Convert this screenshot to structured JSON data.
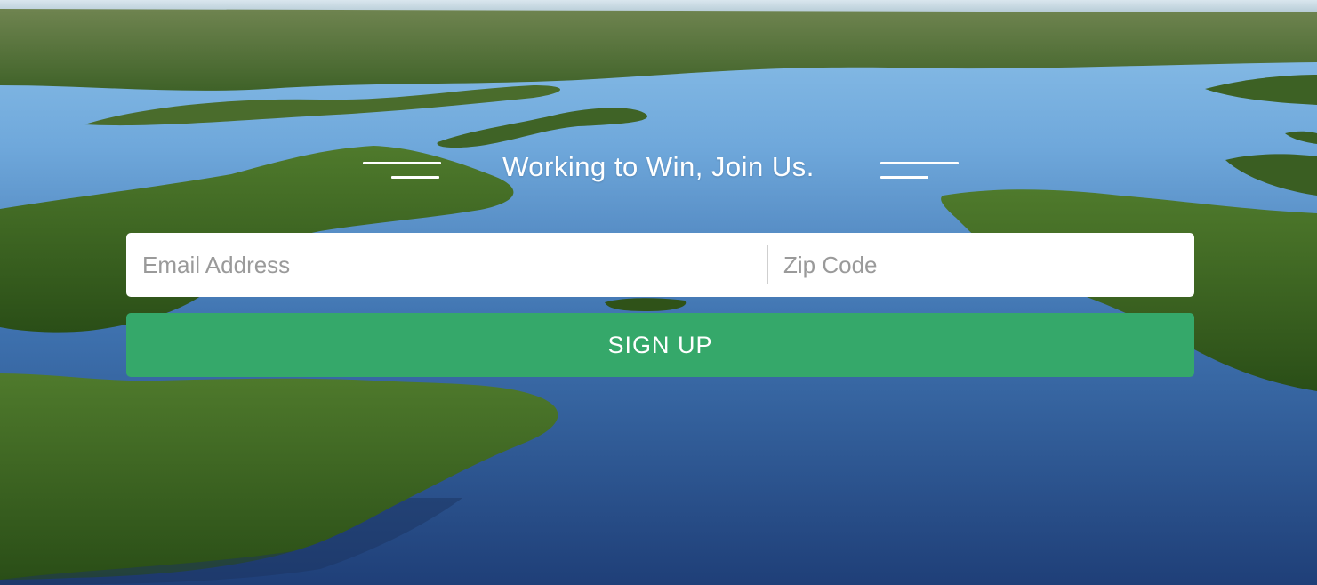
{
  "hero": {
    "heading": "Working to Win, Join Us.",
    "background": "aerial-wetlands-photo"
  },
  "form": {
    "email_placeholder": "Email Address",
    "zip_placeholder": "Zip Code",
    "email_value": "",
    "zip_value": "",
    "submit_label": "SIGN UP"
  },
  "colors": {
    "button": "#35a86a",
    "field_bg": "#ffffff",
    "text_light": "#ffffff",
    "placeholder": "#9a9a9a"
  }
}
